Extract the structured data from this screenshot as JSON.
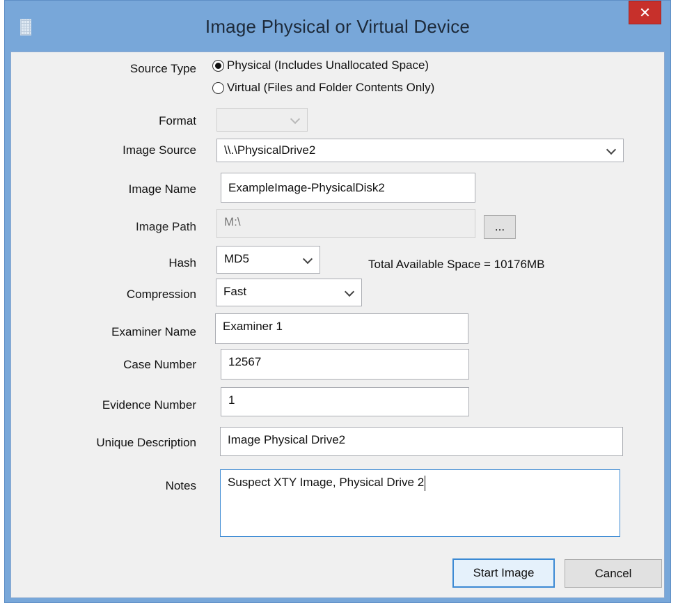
{
  "window": {
    "title": "Image Physical or Virtual Device",
    "close_glyph": "✕"
  },
  "source_type": {
    "label": "Source Type",
    "options": [
      {
        "label": "Physical (Includes Unallocated Space)",
        "selected": true
      },
      {
        "label": "Virtual (Files and Folder Contents Only)",
        "selected": false
      }
    ]
  },
  "format": {
    "label": "Format",
    "value": ""
  },
  "image_source": {
    "label": "Image Source",
    "value": "\\\\.\\PhysicalDrive2"
  },
  "image_name": {
    "label": "Image Name",
    "value": "ExampleImage-PhysicalDisk2"
  },
  "image_path": {
    "label": "Image Path",
    "value": "M:\\",
    "browse_label": "..."
  },
  "hash": {
    "label": "Hash",
    "value": "MD5",
    "available_space": "Total Available Space = 10176MB"
  },
  "compression": {
    "label": "Compression",
    "value": "Fast"
  },
  "examiner_name": {
    "label": "Examiner Name",
    "value": "Examiner 1"
  },
  "case_number": {
    "label": "Case Number",
    "value": "12567"
  },
  "evidence_number": {
    "label": "Evidence Number",
    "value": "1"
  },
  "unique_description": {
    "label": "Unique Description",
    "value": "Image Physical Drive2"
  },
  "notes": {
    "label": "Notes",
    "value": "Suspect XTY Image, Physical Drive 2"
  },
  "buttons": {
    "start": "Start Image",
    "cancel": "Cancel"
  },
  "colors": {
    "title_bar": "#78a7d9",
    "close": "#c7302b",
    "focus": "#3c8ad4"
  }
}
